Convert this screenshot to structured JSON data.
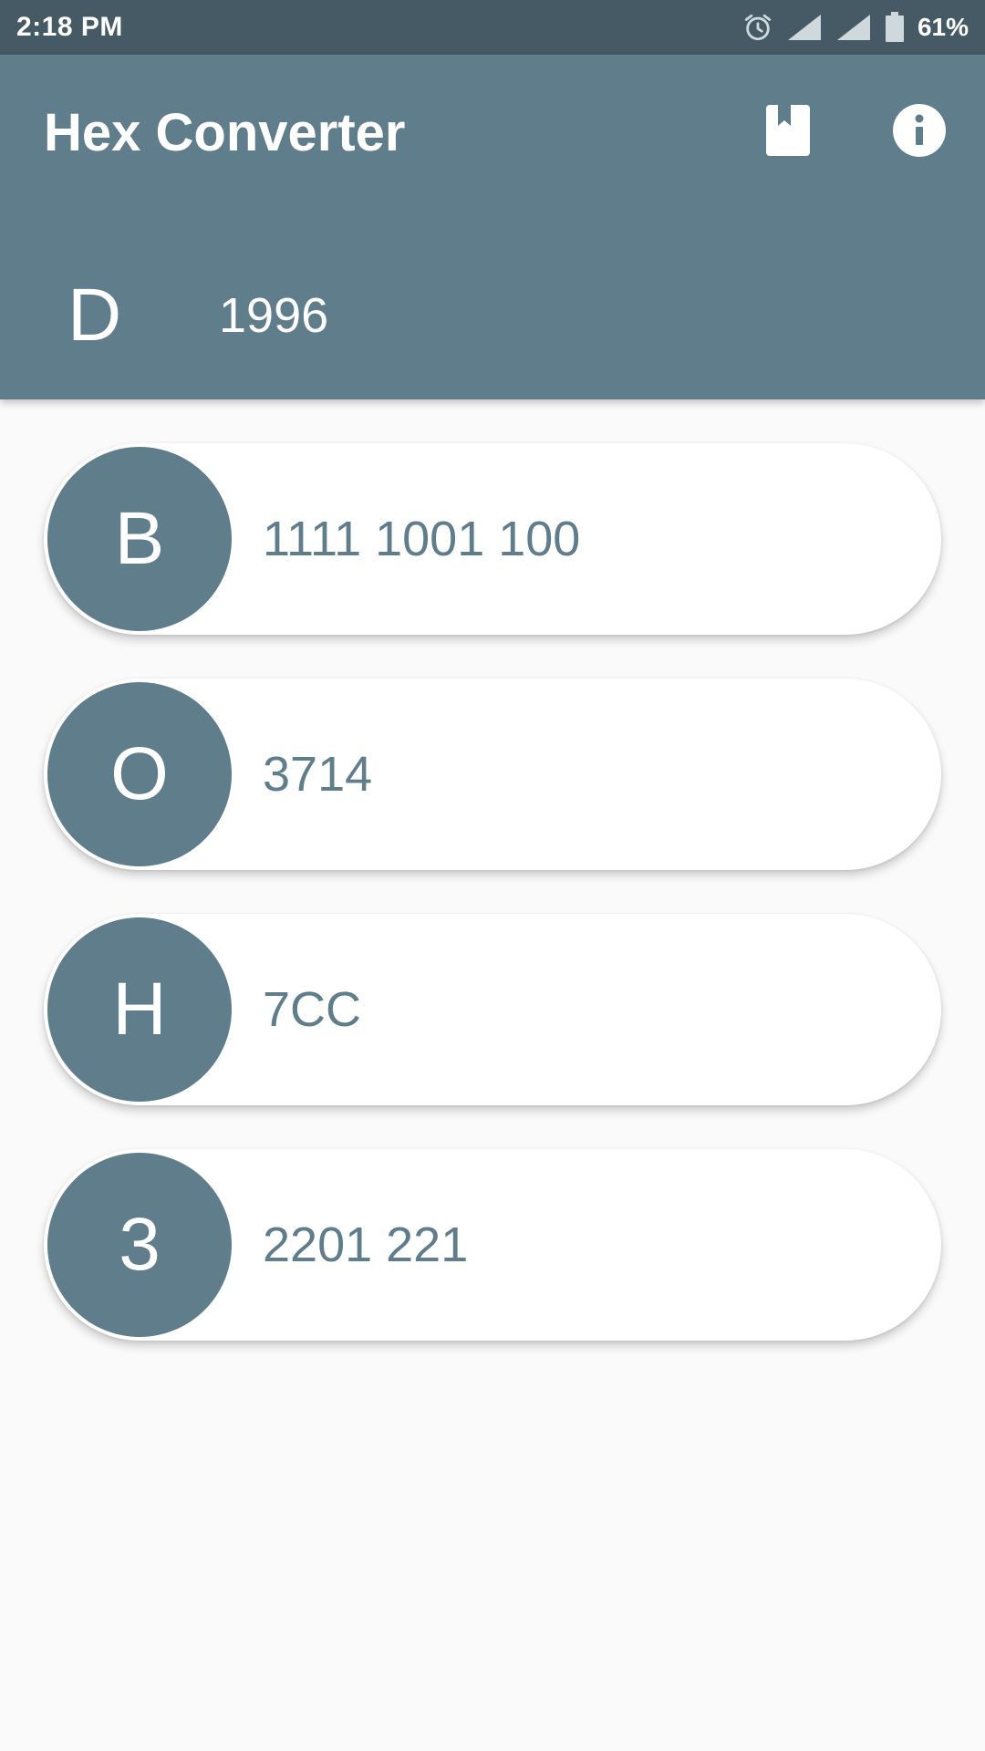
{
  "status_bar": {
    "time": "2:18 PM",
    "battery_percent": "61%",
    "icons": [
      "alarm-icon",
      "signal-icon",
      "signal-icon",
      "battery-icon"
    ]
  },
  "app_bar": {
    "title": "Hex Converter",
    "actions": [
      "bookmark-icon",
      "info-icon"
    ]
  },
  "input": {
    "label": "D",
    "value": "1996"
  },
  "results": [
    {
      "label": "B",
      "value": "1111 1001 100"
    },
    {
      "label": "O",
      "value": "3714"
    },
    {
      "label": "H",
      "value": "7CC"
    },
    {
      "label": "3",
      "value": "2201 221"
    }
  ],
  "colors": {
    "primary": "#607D8B",
    "primary_dark": "#455A64",
    "background": "#FAFAFA",
    "surface": "#FFFFFF"
  }
}
